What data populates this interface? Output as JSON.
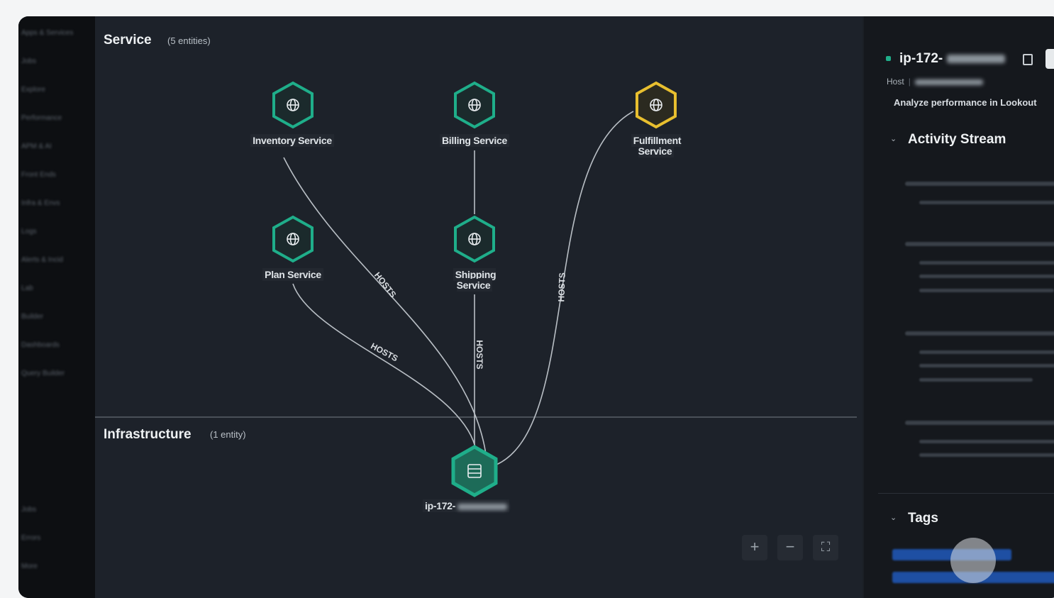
{
  "nav": {
    "items": [
      "Apps & Services",
      "Jobs",
      "Explore",
      "Performance",
      "APM & AI",
      "Front Ends",
      "Infra & Envs",
      "Logs",
      "Alerts & Incid",
      "Lab",
      "Builder",
      "Dashboards",
      "Query Builder",
      "Jobs",
      "Errors",
      "More"
    ]
  },
  "service_section": {
    "title": "Service",
    "count": "(5 entities)"
  },
  "infra_section": {
    "title": "Infrastructure",
    "count": "(1 entity)"
  },
  "nodes": {
    "inventory": "Inventory Service",
    "billing": "Billing Service",
    "fulfillment": "Fulfillment Service",
    "plan": "Plan Service",
    "shipping": "Shipping Service",
    "host": "ip-172-"
  },
  "edges": {
    "label": "HOSTS"
  },
  "zoom": {
    "in": "+",
    "out": "−",
    "fit": "⛶"
  },
  "panel": {
    "host_name": "ip-172-",
    "host_type": "Host",
    "analyze_link": "Analyze performance in Lookout",
    "activity_title": "Activity Stream",
    "tags_title": "Tags"
  },
  "colors": {
    "service_node": "#1fae8a",
    "selected_node": "#e8bf2f",
    "background": "#1d222a"
  }
}
